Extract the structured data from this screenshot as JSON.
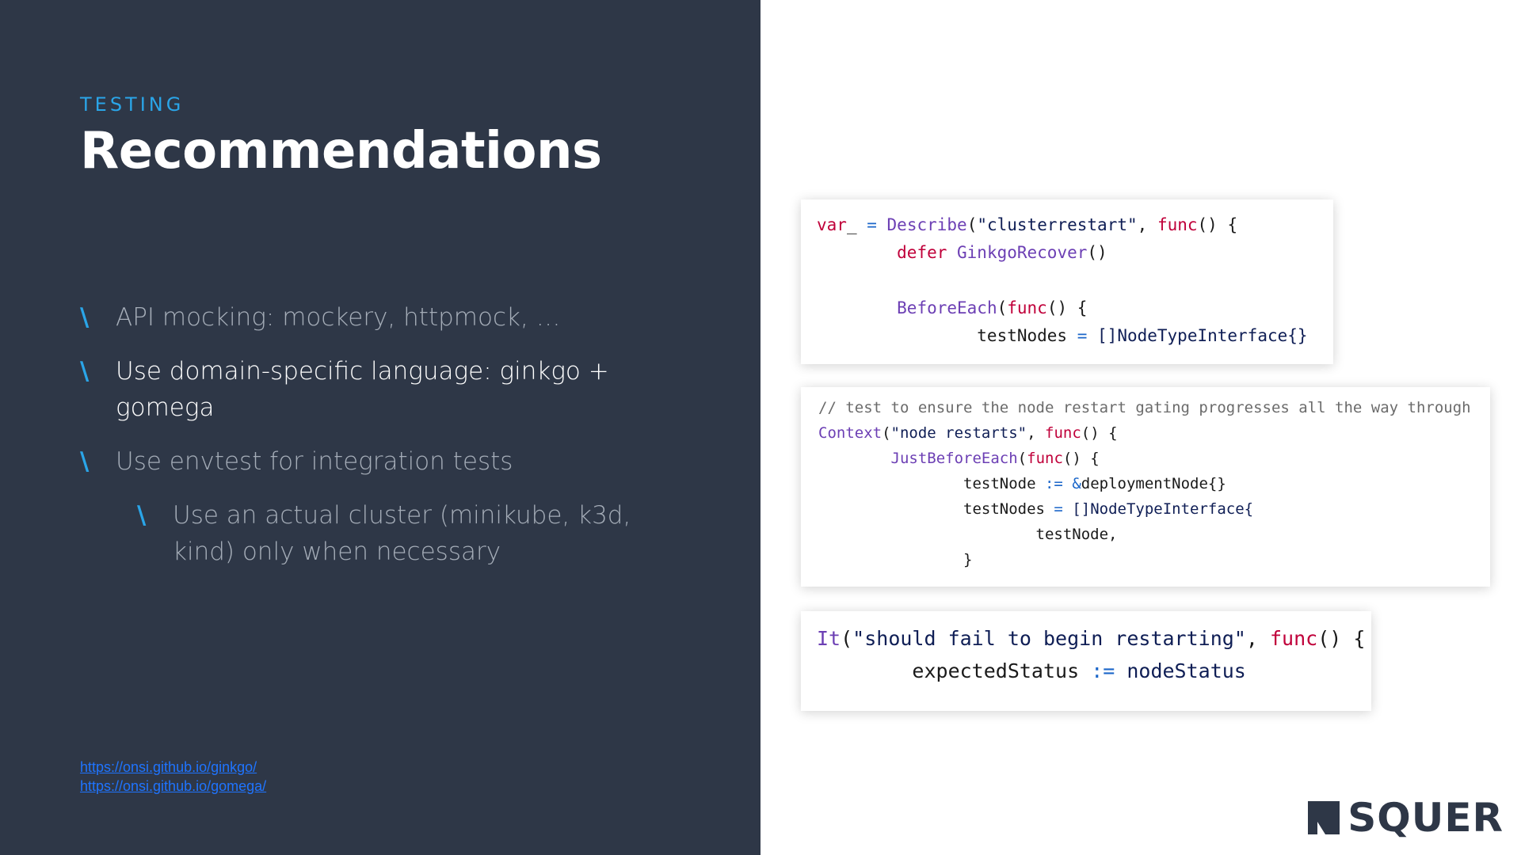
{
  "slide": {
    "eyebrow": "TESTING",
    "title": "Recommendations",
    "bullets": [
      {
        "text": "API mocking: mockery, httpmock, …",
        "active": false,
        "sub": false
      },
      {
        "text": "Use domain-specific language: ginkgo + gomega",
        "active": true,
        "sub": false
      },
      {
        "text": "Use envtest for integration tests",
        "active": false,
        "sub": false
      },
      {
        "text": "Use an actual cluster (minikube, k3d, kind) only when necessary",
        "active": false,
        "sub": true
      }
    ],
    "bullet_mark": "\\",
    "links": [
      "https://onsi.github.io/ginkgo/",
      "https://onsi.github.io/gomega/"
    ]
  },
  "code": {
    "card1": [
      [
        [
          "kw",
          "var"
        ],
        [
          "",
          "_ "
        ],
        [
          "op",
          "="
        ],
        [
          "",
          ""
        ],
        [
          "fn",
          " Describe"
        ],
        [
          "",
          "("
        ],
        [
          "str",
          "\"clusterrestart\""
        ],
        [
          "",
          ", "
        ],
        [
          "kw",
          "func"
        ],
        [
          "",
          "() {"
        ]
      ],
      [
        [
          "",
          "        "
        ],
        [
          "kw",
          "defer"
        ],
        [
          "",
          ""
        ],
        [
          "fn",
          " GinkgoRecover"
        ],
        [
          "",
          "()"
        ]
      ],
      [
        [
          "",
          ""
        ]
      ],
      [
        [
          "",
          "        "
        ],
        [
          "fn",
          "BeforeEach"
        ],
        [
          "",
          "("
        ],
        [
          "kw",
          "func"
        ],
        [
          "",
          "() {"
        ]
      ],
      [
        [
          "",
          "                testNodes "
        ],
        [
          "op",
          "="
        ],
        [
          "",
          ""
        ],
        [
          "str",
          " []NodeTypeInterface{}"
        ]
      ]
    ],
    "card2": [
      [
        [
          "cm",
          "// test to ensure the node restart gating progresses all the way through"
        ]
      ],
      [
        [
          "fn",
          "Context"
        ],
        [
          "",
          "("
        ],
        [
          "str",
          "\"node restarts\""
        ],
        [
          "",
          ", "
        ],
        [
          "kw",
          "func"
        ],
        [
          "",
          "() {"
        ]
      ],
      [
        [
          "",
          "        "
        ],
        [
          "fn",
          "JustBeforeEach"
        ],
        [
          "",
          "("
        ],
        [
          "kw",
          "func"
        ],
        [
          "",
          "() {"
        ]
      ],
      [
        [
          "",
          "                testNode "
        ],
        [
          "op",
          ":="
        ],
        [
          "op",
          " &"
        ],
        [
          "",
          "deploymentNode{}"
        ]
      ],
      [
        [
          "",
          "                testNodes "
        ],
        [
          "op",
          "="
        ],
        [
          "",
          ""
        ],
        [
          "str",
          " []NodeTypeInterface{"
        ]
      ],
      [
        [
          "",
          "                        testNode,"
        ]
      ],
      [
        [
          "",
          "                }"
        ]
      ]
    ],
    "card3": [
      [
        [
          "fn",
          "It"
        ],
        [
          "",
          "("
        ],
        [
          "str",
          "\"should fail to begin restarting\""
        ],
        [
          "",
          ", "
        ],
        [
          "kw",
          "func"
        ],
        [
          "",
          "() {"
        ]
      ],
      [
        [
          "",
          "        expectedStatus "
        ],
        [
          "op",
          ":="
        ],
        [
          "",
          ""
        ],
        [
          "str",
          " nodeStatus"
        ]
      ]
    ]
  },
  "brand": {
    "logo_text": "SQUER",
    "logo_icon": "squer-logo-icon"
  },
  "colors": {
    "panel": "#2e3747",
    "accent": "#2aa5e8",
    "keyword": "#c0003a",
    "function": "#6c3fb4",
    "link": "#1f74ff"
  }
}
